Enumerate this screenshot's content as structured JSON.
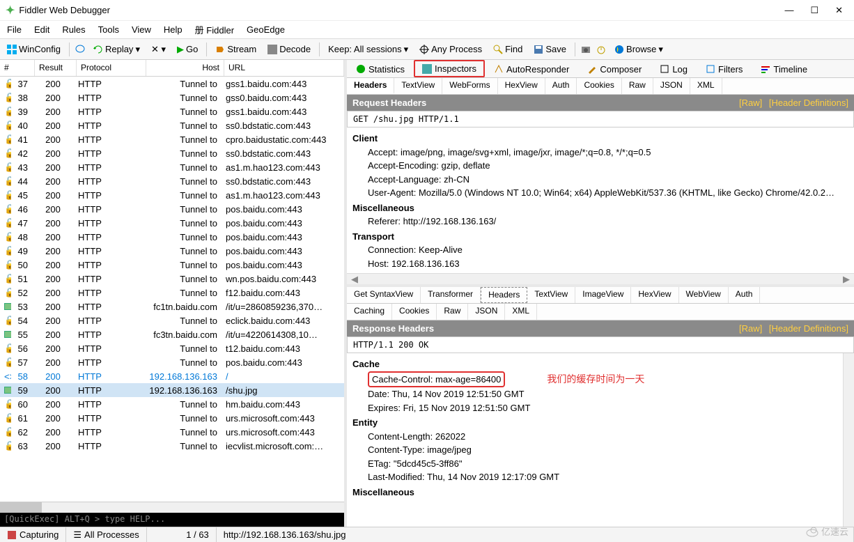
{
  "window": {
    "title": "Fiddler Web Debugger"
  },
  "menu": [
    "File",
    "Edit",
    "Rules",
    "Tools",
    "View",
    "Help",
    "册 Fiddler",
    "GeoEdge"
  ],
  "toolbar": {
    "winconfig": "WinConfig",
    "replay": "Replay",
    "go": "Go",
    "stream": "Stream",
    "decode": "Decode",
    "keep": "Keep: All sessions",
    "anyprocess": "Any Process",
    "find": "Find",
    "save": "Save",
    "browse": "Browse"
  },
  "columns": {
    "id": "#",
    "result": "Result",
    "protocol": "Protocol",
    "host": "Host",
    "url": "URL"
  },
  "sessions": [
    {
      "id": "37",
      "res": "200",
      "proto": "HTTP",
      "host": "Tunnel to",
      "url": "gss1.baidu.com:443",
      "icon": "lock"
    },
    {
      "id": "38",
      "res": "200",
      "proto": "HTTP",
      "host": "Tunnel to",
      "url": "gss0.baidu.com:443",
      "icon": "lock"
    },
    {
      "id": "39",
      "res": "200",
      "proto": "HTTP",
      "host": "Tunnel to",
      "url": "gss1.baidu.com:443",
      "icon": "lock"
    },
    {
      "id": "40",
      "res": "200",
      "proto": "HTTP",
      "host": "Tunnel to",
      "url": "ss0.bdstatic.com:443",
      "icon": "lock"
    },
    {
      "id": "41",
      "res": "200",
      "proto": "HTTP",
      "host": "Tunnel to",
      "url": "cpro.baidustatic.com:443",
      "icon": "lock"
    },
    {
      "id": "42",
      "res": "200",
      "proto": "HTTP",
      "host": "Tunnel to",
      "url": "ss0.bdstatic.com:443",
      "icon": "lock"
    },
    {
      "id": "43",
      "res": "200",
      "proto": "HTTP",
      "host": "Tunnel to",
      "url": "as1.m.hao123.com:443",
      "icon": "lock"
    },
    {
      "id": "44",
      "res": "200",
      "proto": "HTTP",
      "host": "Tunnel to",
      "url": "ss0.bdstatic.com:443",
      "icon": "lock"
    },
    {
      "id": "45",
      "res": "200",
      "proto": "HTTP",
      "host": "Tunnel to",
      "url": "as1.m.hao123.com:443",
      "icon": "lock"
    },
    {
      "id": "46",
      "res": "200",
      "proto": "HTTP",
      "host": "Tunnel to",
      "url": "pos.baidu.com:443",
      "icon": "lock"
    },
    {
      "id": "47",
      "res": "200",
      "proto": "HTTP",
      "host": "Tunnel to",
      "url": "pos.baidu.com:443",
      "icon": "lock"
    },
    {
      "id": "48",
      "res": "200",
      "proto": "HTTP",
      "host": "Tunnel to",
      "url": "pos.baidu.com:443",
      "icon": "lock"
    },
    {
      "id": "49",
      "res": "200",
      "proto": "HTTP",
      "host": "Tunnel to",
      "url": "pos.baidu.com:443",
      "icon": "lock"
    },
    {
      "id": "50",
      "res": "200",
      "proto": "HTTP",
      "host": "Tunnel to",
      "url": "pos.baidu.com:443",
      "icon": "lock"
    },
    {
      "id": "51",
      "res": "200",
      "proto": "HTTP",
      "host": "Tunnel to",
      "url": "wn.pos.baidu.com:443",
      "icon": "lock"
    },
    {
      "id": "52",
      "res": "200",
      "proto": "HTTP",
      "host": "Tunnel to",
      "url": "f12.baidu.com:443",
      "icon": "lock"
    },
    {
      "id": "53",
      "res": "200",
      "proto": "HTTP",
      "host": "fc1tn.baidu.com",
      "url": "/it/u=2860859236,370…",
      "icon": "img"
    },
    {
      "id": "54",
      "res": "200",
      "proto": "HTTP",
      "host": "Tunnel to",
      "url": "eclick.baidu.com:443",
      "icon": "lock"
    },
    {
      "id": "55",
      "res": "200",
      "proto": "HTTP",
      "host": "fc3tn.baidu.com",
      "url": "/it/u=4220614308,10…",
      "icon": "img"
    },
    {
      "id": "56",
      "res": "200",
      "proto": "HTTP",
      "host": "Tunnel to",
      "url": "t12.baidu.com:443",
      "icon": "lock"
    },
    {
      "id": "57",
      "res": "200",
      "proto": "HTTP",
      "host": "Tunnel to",
      "url": "pos.baidu.com:443",
      "icon": "lock"
    },
    {
      "id": "58",
      "res": "200",
      "proto": "HTTP",
      "host": "192.168.136.163",
      "url": "/",
      "icon": "html",
      "blue": true
    },
    {
      "id": "59",
      "res": "200",
      "proto": "HTTP",
      "host": "192.168.136.163",
      "url": "/shu.jpg",
      "icon": "img",
      "sel": true
    },
    {
      "id": "60",
      "res": "200",
      "proto": "HTTP",
      "host": "Tunnel to",
      "url": "hm.baidu.com:443",
      "icon": "lock"
    },
    {
      "id": "61",
      "res": "200",
      "proto": "HTTP",
      "host": "Tunnel to",
      "url": "urs.microsoft.com:443",
      "icon": "lock"
    },
    {
      "id": "62",
      "res": "200",
      "proto": "HTTP",
      "host": "Tunnel to",
      "url": "urs.microsoft.com:443",
      "icon": "lock"
    },
    {
      "id": "63",
      "res": "200",
      "proto": "HTTP",
      "host": "Tunnel to",
      "url": "iecvlist.microsoft.com:…",
      "icon": "lock"
    }
  ],
  "quickexec": "[QuickExec] ALT+Q > type HELP...",
  "right_tabs": [
    "Statistics",
    "Inspectors",
    "AutoResponder",
    "Composer",
    "Log",
    "Filters",
    "Timeline"
  ],
  "req_subtabs": [
    "Headers",
    "TextView",
    "WebForms",
    "HexView",
    "Auth",
    "Cookies",
    "Raw",
    "JSON",
    "XML"
  ],
  "req_header_title": "Request Headers",
  "raw_link": "[Raw]",
  "hdr_def_link": "[Header Definitions]",
  "req_line": "GET /shu.jpg HTTP/1.1",
  "req_sections": {
    "client": "Client",
    "accept": "Accept: image/png, image/svg+xml, image/jxr, image/*;q=0.8, */*;q=0.5",
    "accenc": "Accept-Encoding: gzip, deflate",
    "acclang": "Accept-Language: zh-CN",
    "ua": "User-Agent: Mozilla/5.0 (Windows NT 10.0; Win64; x64) AppleWebKit/537.36 (KHTML, like Gecko) Chrome/42.0.2…",
    "misc": "Miscellaneous",
    "referer": "Referer: http://192.168.136.163/",
    "transport": "Transport",
    "conn": "Connection: Keep-Alive",
    "hosth": "Host: 192.168.136.163"
  },
  "resp_subtabs": [
    "Get SyntaxView",
    "Transformer",
    "Headers",
    "TextView",
    "ImageView",
    "HexView",
    "WebView",
    "Auth"
  ],
  "resp_subtabs2": [
    "Caching",
    "Cookies",
    "Raw",
    "JSON",
    "XML"
  ],
  "resp_header_title": "Response Headers",
  "resp_line": "HTTP/1.1 200 OK",
  "resp_sections": {
    "cache": "Cache",
    "cachectrl": "Cache-Control: max-age=86400",
    "note": "我们的缓存时间为一天",
    "date": "Date: Thu, 14 Nov 2019 12:51:50 GMT",
    "expires": "Expires: Fri, 15 Nov 2019 12:51:50 GMT",
    "entity": "Entity",
    "clen": "Content-Length: 262022",
    "ctype": "Content-Type: image/jpeg",
    "etag": "ETag: \"5dcd45c5-3ff86\"",
    "lastmod": "Last-Modified: Thu, 14 Nov 2019 12:17:09 GMT",
    "misc2": "Miscellaneous"
  },
  "status": {
    "capturing": "Capturing",
    "allproc": "All Processes",
    "count": "1 / 63",
    "url": "http://192.168.136.163/shu.jpg"
  },
  "watermark": "亿速云"
}
